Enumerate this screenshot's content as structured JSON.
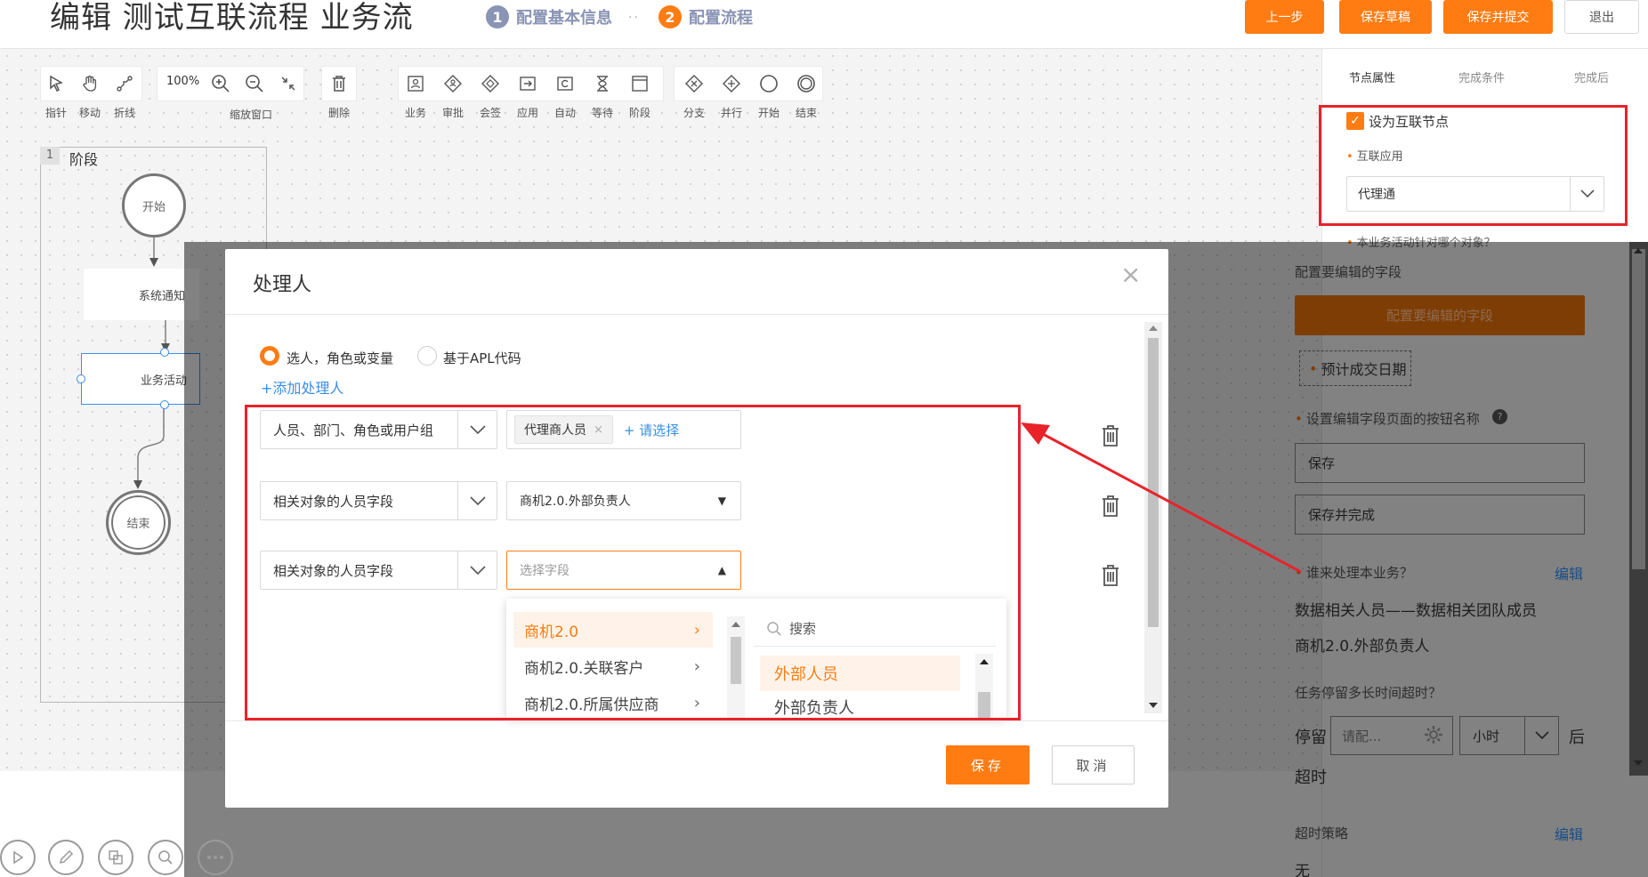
{
  "header": {
    "title": "编辑 测试互联流程 业务流",
    "steps": [
      {
        "num": "1",
        "label": "配置基本信息"
      },
      {
        "num": "2",
        "label": "配置流程"
      }
    ],
    "separator": "··",
    "buttons": {
      "prev": "上一步",
      "draft": "保存草稿",
      "submit": "保存并提交",
      "exit": "退出"
    }
  },
  "toolbar": {
    "zoom": "100%",
    "tools": {
      "pointer": "指针",
      "move": "移动",
      "polyline": "折线",
      "zoom_window": "缩放窗口",
      "delete": "删除",
      "business": "业务",
      "approve": "审批",
      "countersign": "会签",
      "app": "应用",
      "auto": "自动",
      "wait": "等待",
      "stage": "阶段",
      "branch": "分支",
      "parallel": "并行",
      "start": "开始",
      "end": "结束"
    }
  },
  "flow": {
    "stage_num": "1",
    "stage_label": "阶段",
    "start": "开始",
    "system_notify": "系统通知",
    "business_activity": "业务活动",
    "end": "结束"
  },
  "panel": {
    "tabs": [
      "节点属性",
      "完成条件",
      "完成后"
    ],
    "interconnect_checkbox": "设为互联节点",
    "app_label": "互联应用",
    "app_value": "代理通",
    "peek_text": "本业务活动针对哪个对象？",
    "field_title": "配置要编辑的字段",
    "field_button": "配置要编辑的字段",
    "field_tag": "预计成交日期",
    "btn_name_label": "设置编辑字段页面的按钮名称",
    "btn_save": "保存",
    "btn_save_complete": "保存并完成",
    "who_label": "谁来处理本业务？",
    "edit": "编辑",
    "who_values": [
      "数据相关人员——数据相关团队成员",
      "商机2.0.外部负责人"
    ],
    "timeout_label": "任务停留多长时间超时？",
    "stay": "停留",
    "time_placeholder": "请配...",
    "hour": "小时",
    "after": "后",
    "overtime": "超时",
    "strategy_label": "超时策略",
    "strategy_value": "无"
  },
  "modal": {
    "title": "处理人",
    "radio1": "选人，角色或变量",
    "radio2": "基于APL代码",
    "add_handler": "+添加处理人",
    "rows": [
      {
        "type": "人员、部门、角色或用户组",
        "tag": "代理商人员",
        "please_select": "+ 请选择"
      },
      {
        "type": "相关对象的人员字段",
        "value": "商机2.0.外部负责人"
      },
      {
        "type": "相关对象的人员字段",
        "placeholder": "选择字段"
      }
    ],
    "cascader": {
      "left": [
        "商机2.0",
        "商机2.0.关联客户",
        "商机2.0.所属供应商"
      ],
      "search": "搜索",
      "right": [
        "外部人员",
        "外部负责人"
      ]
    },
    "save": "保存",
    "cancel": "取消"
  },
  "colors": {
    "accent": "#ff7c13",
    "highlight": "#e8232a",
    "link": "#3a8ee6"
  }
}
